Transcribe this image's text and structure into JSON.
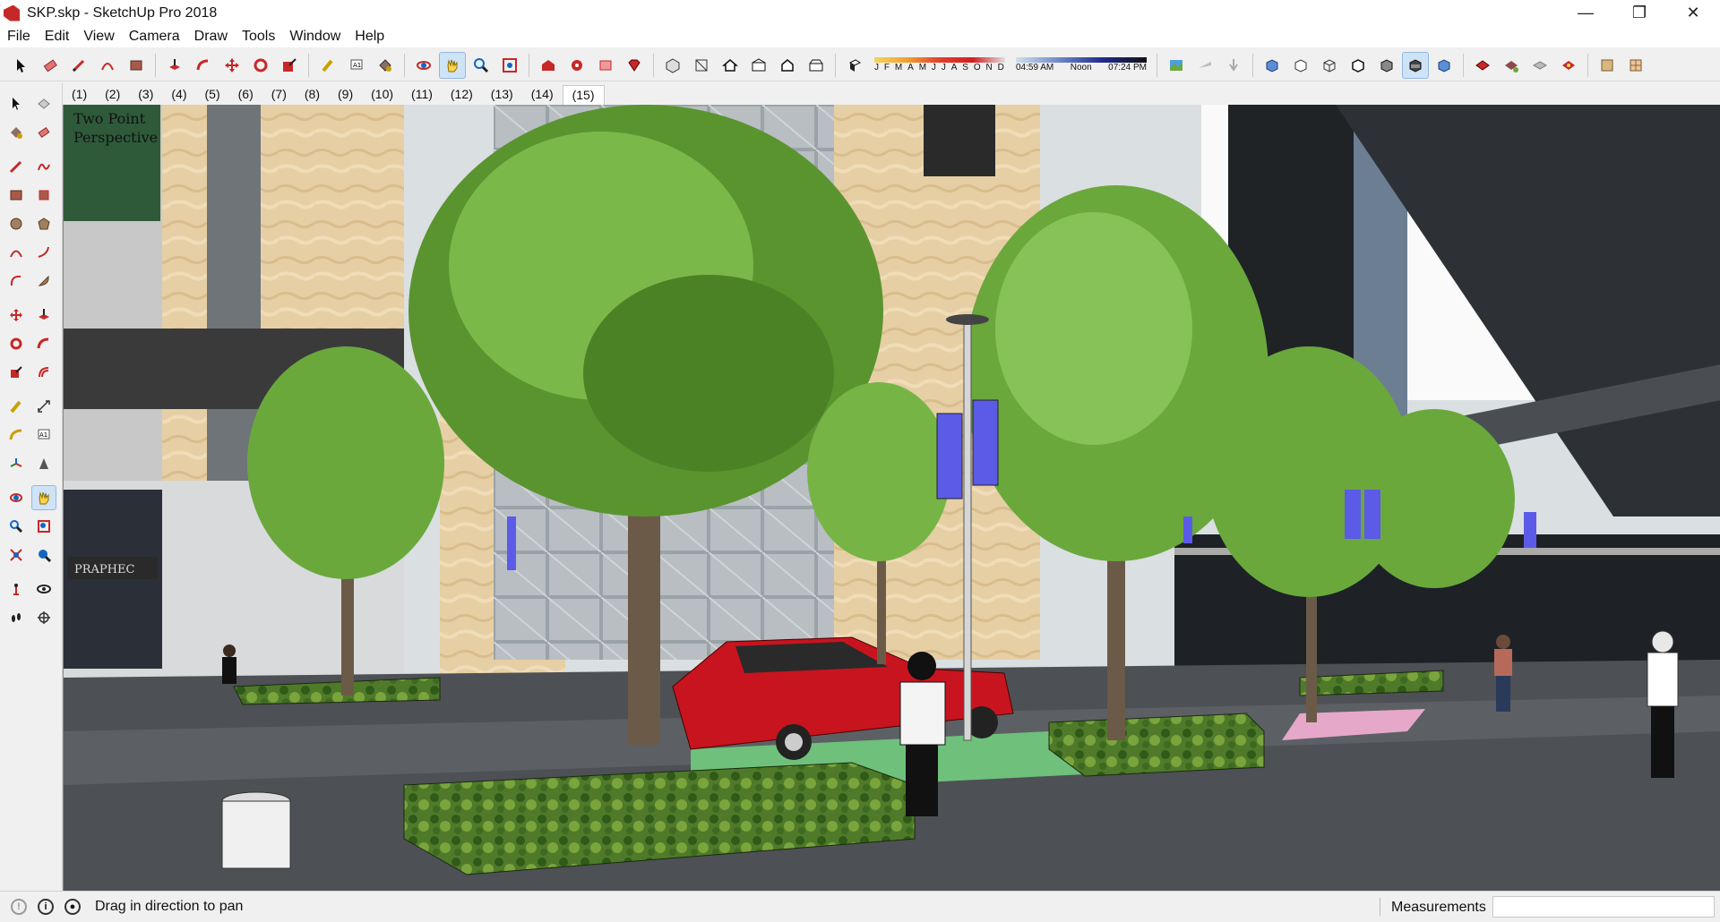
{
  "window": {
    "title": "SKP.skp - SketchUp Pro 2018",
    "minimize": "—",
    "maximize": "❐",
    "close": "✕"
  },
  "menu": [
    "File",
    "Edit",
    "View",
    "Camera",
    "Draw",
    "Tools",
    "Window",
    "Help"
  ],
  "shadows": {
    "months": [
      "J",
      "F",
      "M",
      "A",
      "M",
      "J",
      "J",
      "A",
      "S",
      "O",
      "N",
      "D"
    ],
    "time_start": "04:59 AM",
    "time_mid": "Noon",
    "time_end": "07:24 PM"
  },
  "scenes": [
    "(1)",
    "(2)",
    "(3)",
    "(4)",
    "(5)",
    "(6)",
    "(7)",
    "(8)",
    "(9)",
    "(10)",
    "(11)",
    "(12)",
    "(13)",
    "(14)",
    "(15)"
  ],
  "active_scene": "(15)",
  "viewport": {
    "camera_label_line1": "Two Point",
    "camera_label_line2": "Perspective",
    "sign_text": "PRAPHEC"
  },
  "status": {
    "hint": "Drag in direction to pan",
    "measurements_label": "Measurements",
    "measurements_value": ""
  },
  "colors": {
    "accent_active": "#cfe3f7",
    "banner": "#5b5be8",
    "car": "#c8141e",
    "hedge": "#4f7a2a",
    "tree": "#6aa83c"
  }
}
